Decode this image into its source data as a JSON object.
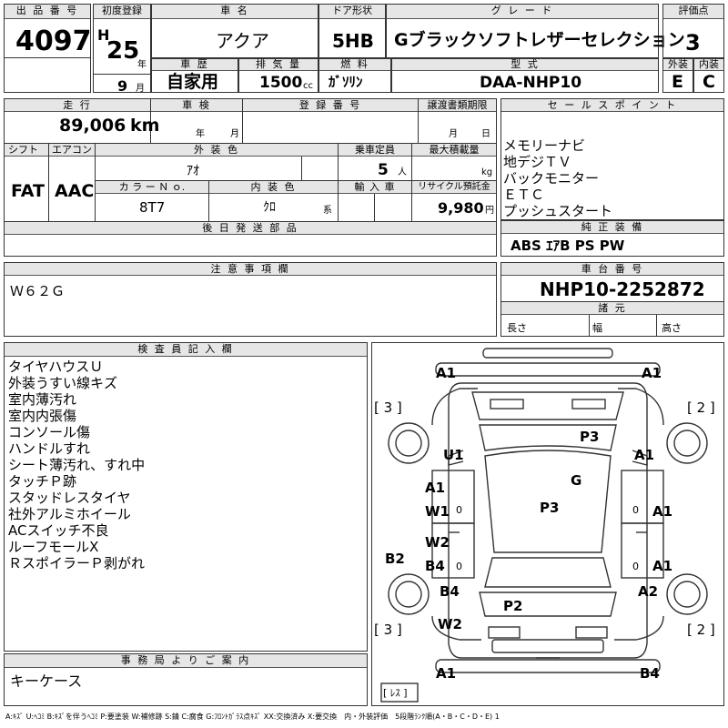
{
  "lot": {
    "label": "出 品 番 号",
    "value": "4097"
  },
  "first_reg": {
    "label": "初度登録",
    "era": "H",
    "year": "25",
    "year_unit": "年",
    "month": "9",
    "month_unit": "月"
  },
  "car_name": {
    "label": "車 名",
    "value": "アクア"
  },
  "door": {
    "label": "ドア形状",
    "value": "5HB"
  },
  "grade": {
    "label": "グ レ ー ド",
    "value": "Gブラックソフトレザーセレクション"
  },
  "score": {
    "label": "評価点",
    "value": "3"
  },
  "history": {
    "label": "車 歴",
    "value": "自家用"
  },
  "displacement": {
    "label": "排 気 量",
    "value": "1500",
    "unit": "cc"
  },
  "fuel": {
    "label": "燃 料",
    "value": "ｶﾞｿﾘﾝ"
  },
  "model": {
    "label": "型 式",
    "value": "DAA-NHP10"
  },
  "ext_grade": {
    "label": "外装",
    "value": "E"
  },
  "int_grade": {
    "label": "内装",
    "value": "C"
  },
  "mileage": {
    "label": "走 行",
    "value": "89,006",
    "unit": "km"
  },
  "inspection": {
    "label": "車 検",
    "year_unit": "年",
    "month_unit": "月"
  },
  "reg_no": {
    "label": "登 録 番 号"
  },
  "transfer": {
    "label": "譲渡書類期限",
    "month_unit": "月",
    "day_unit": "日"
  },
  "shift": {
    "label": "シフト",
    "value": "FAT"
  },
  "aircon": {
    "label": "エアコン",
    "value": "AAC"
  },
  "ext_color": {
    "label": "外 装 色",
    "value": "ｱｵ"
  },
  "capacity": {
    "label": "乗車定員",
    "value": "5",
    "unit": "人"
  },
  "max_load": {
    "label": "最大積載量",
    "unit": "kg"
  },
  "color_no": {
    "label": "カ ラ ー Ｎ ｏ.",
    "value": "8T7"
  },
  "int_color": {
    "label": "内 装 色",
    "value": "ｸﾛ",
    "unit": "系"
  },
  "import": {
    "label": "輸 入 車"
  },
  "recycle": {
    "label": "リサイクル預託金",
    "value": "9,980",
    "unit": "円"
  },
  "later_parts": {
    "label": "後 日 発 送 部 品"
  },
  "sales_points": {
    "label": "セ ー ル ス ポ イ ン ト",
    "items": [
      "メモリーナビ",
      "地デジＴＶ",
      "バックモニター",
      "ＥＴＣ",
      "プッシュスタート"
    ]
  },
  "equipment": {
    "label": "純 正 装 備",
    "value": "ABS ｴｱB PS PW"
  },
  "notes": {
    "label": "注 意 事 項 欄",
    "value": "Ｗ６２Ｇ"
  },
  "chassis": {
    "label": "車 台 番 号",
    "value": "NHP10-2252872"
  },
  "dims": {
    "label": "諸 元",
    "length": "長さ",
    "width": "幅",
    "height": "高さ"
  },
  "inspector": {
    "label": "検 査 員 記 入 欄",
    "lines": [
      "タイヤハウスＵ",
      "外装うすい線キズ",
      "室内薄汚れ",
      "室内内張傷",
      "コンソール傷",
      "ハンドルすれ",
      "シート薄汚れ、すれ中",
      "タッチＰ跡",
      "スタッドレスタイヤ",
      "社外アルミホイール",
      "ACスイッチ不良",
      "ルーフモールX",
      "ＲスポイラーＰ剥がれ"
    ]
  },
  "office": {
    "label": "事 務 局 よ り ご 案 内",
    "value": "キーケース"
  },
  "diagram": {
    "tire_left_top": "[ 3 ]",
    "tire_right_top": "[ 2 ]",
    "tire_left_bottom": "[ 3 ]",
    "tire_right_bottom": "[ 2 ]",
    "spare": "[ ﾚｽ ]",
    "marks": [
      "A1",
      "A1",
      "U1",
      "P3",
      "A1",
      "A1",
      "G",
      "W1",
      "P3",
      "A1",
      "W2",
      "B2",
      "B4",
      "A1",
      "B4",
      "A2",
      "P2",
      "W2",
      "A1",
      "B4"
    ],
    "small_marks": [
      "0",
      "0",
      "0",
      "0"
    ]
  },
  "legend": "A:ｷｽﾞ U:ﾍｺﾐ B:ｷｽﾞを伴うﾍｺﾐ P:要塗装 W:補修跡 S:錆 C:腐食 G:ﾌﾛﾝﾄｶﾞﾗｽ点ｷｽﾞ XX:交換済み X:要交換　内・外装評価　5段階ﾗﾝｸ順(A・B・C・D・E) 1"
}
